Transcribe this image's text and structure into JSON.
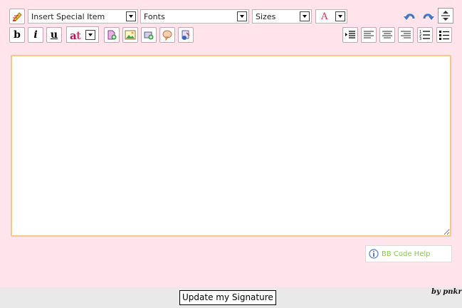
{
  "toolbar": {
    "special_item": "Insert Special Item",
    "fonts": "Fonts",
    "sizes": "Sizes",
    "bold_label": "b",
    "italic_label": "i",
    "underline_label": "u"
  },
  "editor": {
    "value": "",
    "placeholder": ""
  },
  "help": {
    "label": "BB Code Help"
  },
  "footer": {
    "submit_label": "Update my Signature",
    "credit": "by pnkr"
  }
}
